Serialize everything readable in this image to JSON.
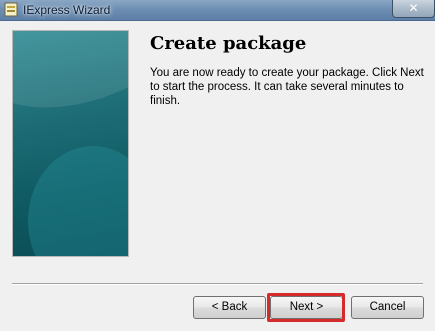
{
  "window": {
    "title": "IExpress Wizard",
    "icon": "iexpress-app-icon",
    "close_icon": "close-x-icon"
  },
  "content": {
    "heading": "Create package",
    "description": "You are now ready to create your package.  Click Next to start the process.  It can take several minutes to finish."
  },
  "buttons": {
    "back": "< Back",
    "next": "Next >",
    "cancel": "Cancel"
  },
  "colors": {
    "highlight": "#d52b2b",
    "panel_teal": "#0f5a63"
  }
}
